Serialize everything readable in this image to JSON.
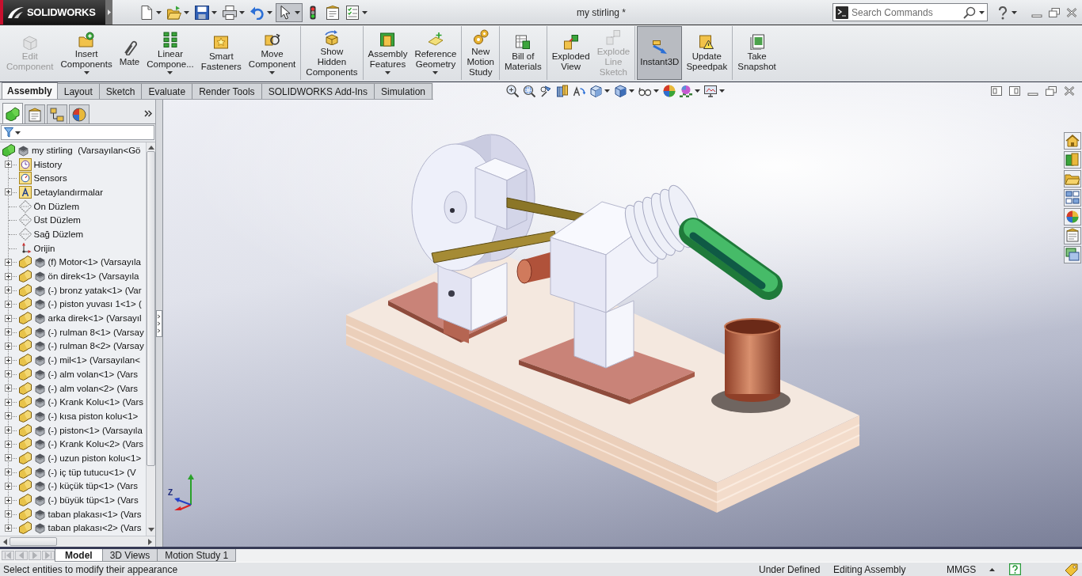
{
  "title_bar": {
    "app_name": "SOLIDWORKS",
    "quick_access": [
      {
        "kind": "new",
        "dropdown": true,
        "pressed": false
      },
      {
        "kind": "open",
        "dropdown": true,
        "pressed": false
      },
      {
        "kind": "save",
        "dropdown": true,
        "pressed": false
      },
      {
        "kind": "print",
        "dropdown": true,
        "pressed": false
      },
      {
        "kind": "undo",
        "dropdown": true,
        "pressed": false
      },
      {
        "kind": "select",
        "dropdown": true,
        "pressed": true
      },
      {
        "kind": "rebuild",
        "dropdown": false,
        "pressed": false
      },
      {
        "kind": "file_properties",
        "dropdown": false,
        "pressed": false
      },
      {
        "kind": "options",
        "dropdown": true,
        "pressed": false
      }
    ],
    "document_title": "my stirling *",
    "search": {
      "placeholder": "Search Commands"
    }
  },
  "ribbon": {
    "groups": [
      {
        "buttons": [
          {
            "kind": "edit_component",
            "label": "Edit\nComponent",
            "dropdown": false,
            "disabled": true,
            "pressed": false
          },
          {
            "kind": "insert_components",
            "label": "Insert\nComponents",
            "dropdown": true,
            "disabled": false,
            "pressed": false
          },
          {
            "kind": "mate",
            "label": "Mate",
            "dropdown": false,
            "disabled": false,
            "pressed": false
          },
          {
            "kind": "linear_pattern",
            "label": "Linear\nCompone...",
            "dropdown": true,
            "disabled": false,
            "pressed": false
          },
          {
            "kind": "smart_fasteners",
            "label": "Smart\nFasteners",
            "dropdown": false,
            "disabled": false,
            "pressed": false
          },
          {
            "kind": "move_component",
            "label": "Move\nComponent",
            "dropdown": true,
            "disabled": false,
            "pressed": false
          }
        ]
      },
      {
        "buttons": [
          {
            "kind": "show_hidden",
            "label": "Show\nHidden\nComponents",
            "dropdown": false,
            "disabled": false,
            "pressed": false
          }
        ]
      },
      {
        "buttons": [
          {
            "kind": "assembly_features",
            "label": "Assembly\nFeatures",
            "dropdown": true,
            "disabled": false,
            "pressed": false
          },
          {
            "kind": "reference_geometry",
            "label": "Reference\nGeometry",
            "dropdown": true,
            "disabled": false,
            "pressed": false
          }
        ]
      },
      {
        "buttons": [
          {
            "kind": "motion_study",
            "label": "New\nMotion\nStudy",
            "dropdown": false,
            "disabled": false,
            "pressed": false
          }
        ]
      },
      {
        "buttons": [
          {
            "kind": "bill_of_materials",
            "label": "Bill of\nMaterials",
            "dropdown": false,
            "disabled": false,
            "pressed": false
          }
        ]
      },
      {
        "buttons": [
          {
            "kind": "exploded_view",
            "label": "Exploded\nView",
            "dropdown": false,
            "disabled": false,
            "pressed": false
          },
          {
            "kind": "explode_line_sketch",
            "label": "Explode\nLine\nSketch",
            "dropdown": false,
            "disabled": true,
            "pressed": false
          }
        ]
      },
      {
        "buttons": [
          {
            "kind": "instant3d",
            "label": "Instant3D",
            "dropdown": false,
            "disabled": false,
            "pressed": true
          },
          {
            "kind": "speedpak",
            "label": "Update\nSpeedpak",
            "dropdown": false,
            "disabled": false,
            "pressed": false
          }
        ]
      },
      {
        "buttons": [
          {
            "kind": "snapshot",
            "label": "Take\nSnapshot",
            "dropdown": false,
            "disabled": false,
            "pressed": false
          }
        ]
      }
    ]
  },
  "command_tabs": [
    {
      "label": "Assembly",
      "selected": true
    },
    {
      "label": "Layout",
      "selected": false
    },
    {
      "label": "Sketch",
      "selected": false
    },
    {
      "label": "Evaluate",
      "selected": false
    },
    {
      "label": "Render Tools",
      "selected": false
    },
    {
      "label": "SOLIDWORKS Add-Ins",
      "selected": false
    },
    {
      "label": "Simulation",
      "selected": false
    }
  ],
  "feature_manager": {
    "panel_tabs": [
      {
        "kind": "features",
        "selected": true
      },
      {
        "kind": "properties",
        "selected": false
      },
      {
        "kind": "configurations",
        "selected": false
      },
      {
        "kind": "display",
        "selected": false
      }
    ],
    "tree": {
      "kind": "assembly",
      "label": "my stirling  (Varsayılan<Gö",
      "children": [
        {
          "kind": "history",
          "label": "History",
          "expanded": false
        },
        {
          "kind": "sensors",
          "label": "Sensors"
        },
        {
          "kind": "annotations",
          "label": "Detaylandırmalar",
          "expanded": false
        },
        {
          "kind": "plane",
          "label": "Ön Düzlem"
        },
        {
          "kind": "plane",
          "label": "Üst Düzlem"
        },
        {
          "kind": "plane",
          "label": "Sağ Düzlem"
        },
        {
          "kind": "origin",
          "label": "Orijin"
        },
        {
          "kind": "part",
          "label": "(f) Motor<1> (Varsayıla",
          "expanded": false
        },
        {
          "kind": "part",
          "label": "ön direk<1> (Varsayıla",
          "expanded": false
        },
        {
          "kind": "part",
          "label": "(-) bronz yatak<1> (Var",
          "expanded": false
        },
        {
          "kind": "part",
          "label": "(-) piston yuvası 1<1> (",
          "expanded": false
        },
        {
          "kind": "part",
          "label": "arka direk<1> (Varsayıl",
          "expanded": false
        },
        {
          "kind": "part",
          "label": "(-) rulman 8<1> (Varsay",
          "expanded": false
        },
        {
          "kind": "part",
          "label": "(-) rulman 8<2> (Varsay",
          "expanded": false
        },
        {
          "kind": "part",
          "label": "(-) mil<1> (Varsayılan<",
          "expanded": false
        },
        {
          "kind": "part",
          "label": "(-) alm volan<1> (Vars",
          "expanded": false
        },
        {
          "kind": "part",
          "label": "(-) alm volan<2> (Vars",
          "expanded": false
        },
        {
          "kind": "part",
          "label": "(-) Krank Kolu<1> (Vars",
          "expanded": false
        },
        {
          "kind": "part",
          "label": "(-) kısa piston kolu<1>",
          "expanded": false
        },
        {
          "kind": "part",
          "label": "(-) piston<1> (Varsayıla",
          "expanded": false
        },
        {
          "kind": "part",
          "label": "(-) Krank Kolu<2> (Vars",
          "expanded": false
        },
        {
          "kind": "part",
          "label": "(-) uzun piston kolu<1>",
          "expanded": false
        },
        {
          "kind": "part",
          "label": "(-) iç tüp tutucu<1> (V",
          "expanded": false
        },
        {
          "kind": "part",
          "label": "(-) küçük tüp<1> (Vars",
          "expanded": false
        },
        {
          "kind": "part",
          "label": "(-) büyük tüp<1> (Vars",
          "expanded": false
        },
        {
          "kind": "part",
          "label": "taban plakası<1> (Vars",
          "expanded": false
        },
        {
          "kind": "part",
          "label": "taban plakası<2> (Vars",
          "expanded": false
        }
      ]
    }
  },
  "viewport": {
    "triad": {
      "label": "Z"
    }
  },
  "bottom_tabs": [
    {
      "label": "Model",
      "selected": true
    },
    {
      "label": "3D Views",
      "selected": false
    },
    {
      "label": "Motion Study 1",
      "selected": false
    }
  ],
  "status_bar": {
    "message": "Select entities to modify their appearance",
    "definition": "Under Defined",
    "mode": "Editing Assembly",
    "units": "MMGS"
  }
}
